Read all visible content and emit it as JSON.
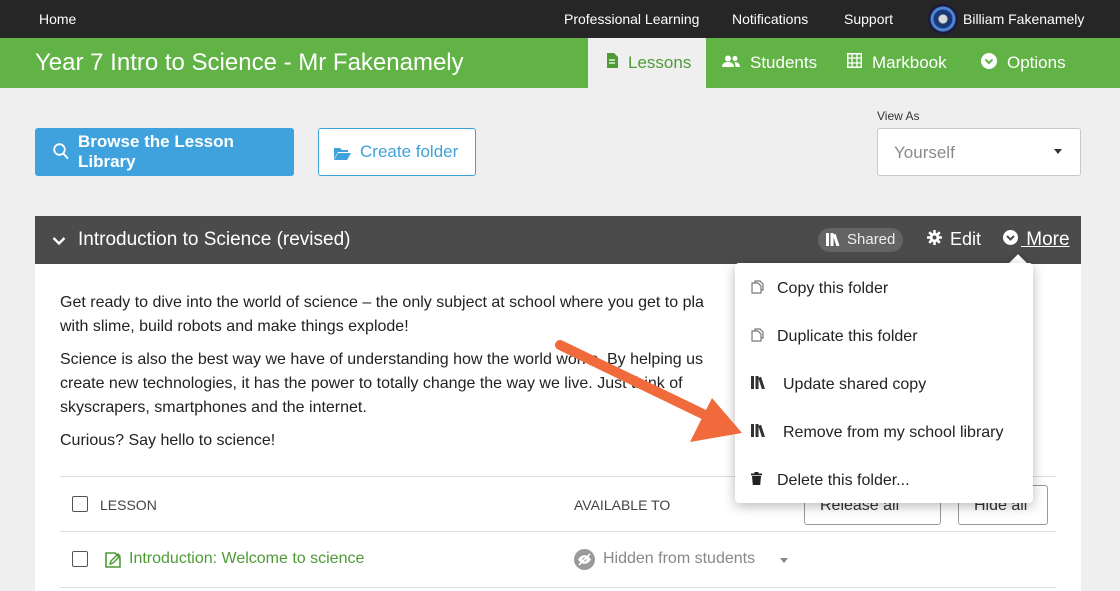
{
  "topbar": {
    "home": "Home",
    "nav": [
      "Professional Learning",
      "Notifications",
      "Support"
    ],
    "user_name": "Billiam Fakenamely"
  },
  "course": {
    "title": "Year 7 Intro to Science - Mr Fakenamely",
    "tabs": [
      {
        "label": "Lessons",
        "active": true
      },
      {
        "label": "Students",
        "active": false
      },
      {
        "label": "Markbook",
        "active": false
      },
      {
        "label": "Options",
        "active": false
      }
    ]
  },
  "toolbar": {
    "browse_label": "Browse the Lesson Library",
    "create_folder_label": "Create folder",
    "view_as_label": "View As",
    "view_as_value": "Yourself"
  },
  "folder": {
    "title": "Introduction to Science (revised)",
    "shared_badge": "Shared",
    "edit_label": "Edit",
    "more_label": "More",
    "description": [
      "Get ready to dive into the world of science – the only subject at school where you get to pla",
      "with slime, build robots and make things explode!",
      "Science is also the best way we have of understanding how the world works. By helping us",
      "create new technologies, it has the power to totally change the way we live. Just think of",
      "skyscrapers, smartphones and the internet.",
      "Curious? Say hello to science!"
    ],
    "table": {
      "col_lesson": "LESSON",
      "col_available": "AVAILABLE TO",
      "release_all": "Release all",
      "hide_all": "Hide all"
    },
    "lessons": [
      {
        "title": "Introduction: Welcome to science",
        "status": "Hidden from students"
      }
    ]
  },
  "more_menu": [
    {
      "label": "Copy this folder",
      "icon": "copy-icon"
    },
    {
      "label": "Duplicate this folder",
      "icon": "copy-icon"
    },
    {
      "label": "Update shared copy",
      "icon": "library-icon"
    },
    {
      "label": "Remove from my school library",
      "icon": "library-icon"
    },
    {
      "label": "Delete this folder...",
      "icon": "trash-icon"
    }
  ],
  "colors": {
    "topbar": "#262626",
    "brand_green": "#62b346",
    "link_blue": "#3fa2dc",
    "panel_header": "#4b4b4b",
    "arrow": "#f06a3c"
  }
}
